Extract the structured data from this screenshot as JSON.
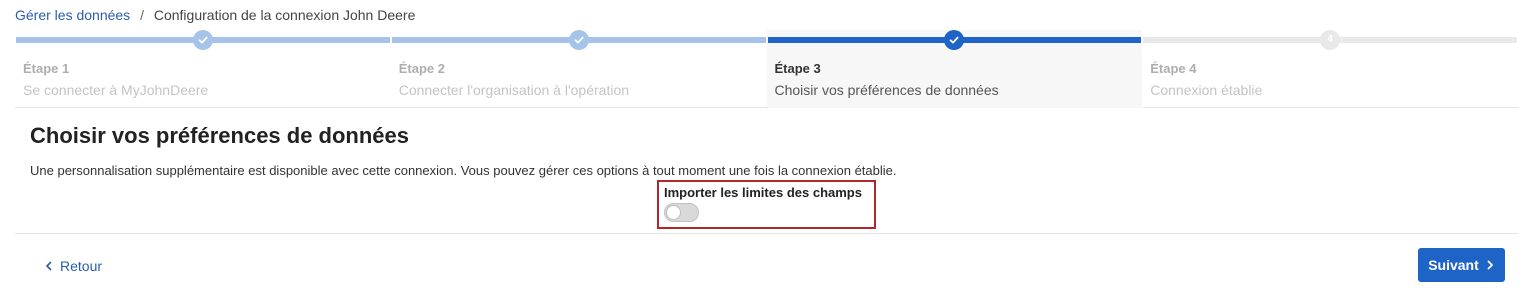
{
  "breadcrumb": {
    "link": "Gérer les données",
    "separator": "/",
    "current": "Configuration de la connexion John Deere"
  },
  "steps": [
    {
      "title": "Étape 1",
      "subtitle": "Se connecter à MyJohnDeere",
      "state": "done",
      "marker": "check-icon"
    },
    {
      "title": "Étape 2",
      "subtitle": "Connecter l'organisation à l'opération",
      "state": "done",
      "marker": "check-icon"
    },
    {
      "title": "Étape 3",
      "subtitle": "Choisir vos préférences de données",
      "state": "current",
      "marker": "check-icon"
    },
    {
      "title": "Étape 4",
      "subtitle": "Connexion établie",
      "state": "pending",
      "marker": "4"
    }
  ],
  "main": {
    "heading": "Choisir vos préférences de données",
    "description": "Une personnalisation supplémentaire est disponible avec cette connexion. Vous pouvez gérer ces options à tout moment une fois la connexion établie.",
    "option": {
      "label": "Importer les limites des champs",
      "enabled": false
    }
  },
  "footer": {
    "back_label": "Retour",
    "next_label": "Suivant"
  },
  "colors": {
    "primary": "#1e63c6",
    "done": "#a6c4ea",
    "pending": "#e9e9e9",
    "highlight_border": "#b3262a"
  }
}
